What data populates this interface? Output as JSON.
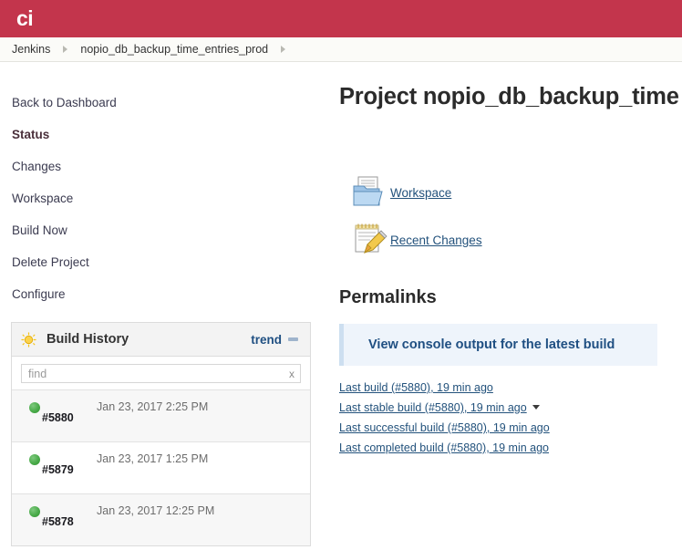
{
  "header": {
    "logo_text": "ci",
    "logo_bg_color": "#c3354c"
  },
  "breadcrumb": {
    "items": [
      {
        "label": "Jenkins"
      },
      {
        "label": "nopio_db_backup_time_entries_prod"
      }
    ]
  },
  "sidebar": {
    "items": [
      {
        "label": "Back to Dashboard",
        "active": false
      },
      {
        "label": "Status",
        "active": true
      },
      {
        "label": "Changes",
        "active": false
      },
      {
        "label": "Workspace",
        "active": false
      },
      {
        "label": "Build Now",
        "active": false
      },
      {
        "label": "Delete Project",
        "active": false
      },
      {
        "label": "Configure",
        "active": false
      }
    ]
  },
  "build_history": {
    "icon": "sun-icon",
    "title": "Build History",
    "trend_label": "trend",
    "collapse_icon": "minus-icon",
    "find_placeholder": "find",
    "find_value": "",
    "clear_label": "x",
    "builds": [
      {
        "status": "green",
        "number": "#5880",
        "date": "Jan 23, 2017 2:25 PM"
      },
      {
        "status": "green",
        "number": "#5879",
        "date": "Jan 23, 2017 1:25 PM"
      },
      {
        "status": "green",
        "number": "#5878",
        "date": "Jan 23, 2017 12:25 PM"
      }
    ]
  },
  "main": {
    "project_title": "Project nopio_db_backup_time",
    "quicklinks": [
      {
        "icon": "workspace-folder-icon",
        "label": "Workspace"
      },
      {
        "icon": "recent-changes-notepad-icon",
        "label": "Recent Changes"
      }
    ],
    "permalinks_title": "Permalinks",
    "callout_label": "View console output for the latest build",
    "permalinks": [
      {
        "label": "Last build (#5880), 19 min ago",
        "has_caret": false
      },
      {
        "label": "Last stable build (#5880), 19 min ago",
        "has_caret": true
      },
      {
        "label": "Last successful build (#5880), 19 min ago",
        "has_caret": false
      },
      {
        "label": "Last completed build (#5880), 19 min ago",
        "has_caret": false
      }
    ]
  }
}
